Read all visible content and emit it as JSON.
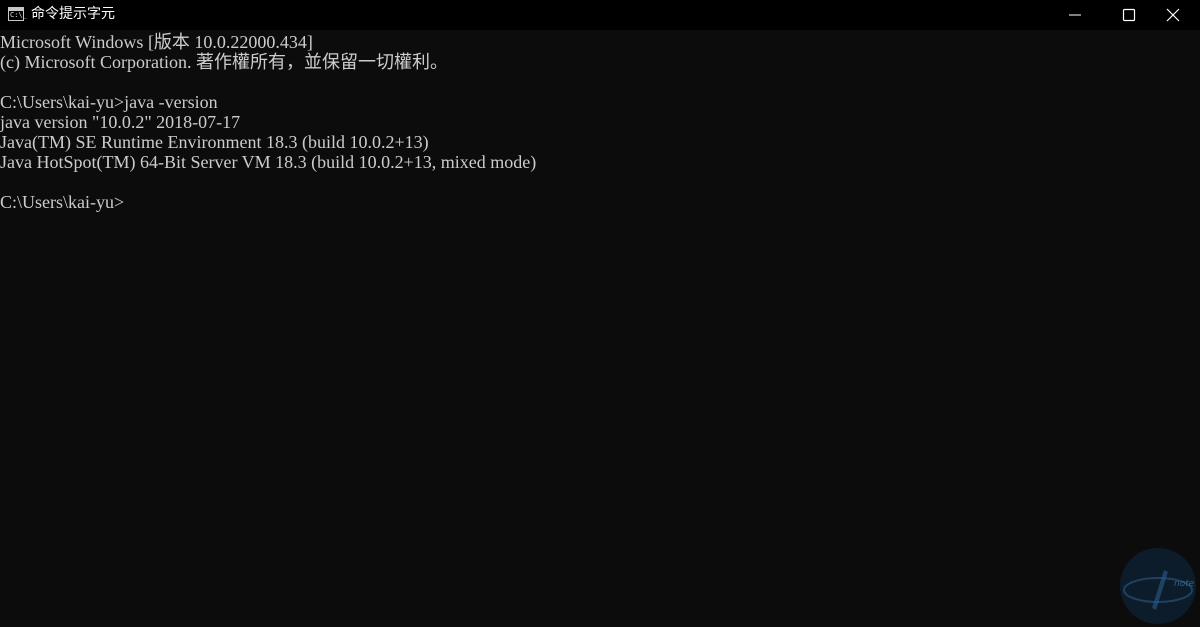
{
  "window": {
    "title": "命令提示字元",
    "app_icon_glyph": "C:\\_"
  },
  "console": {
    "lines": [
      "Microsoft Windows [版本 10.0.22000.434]",
      "(c) Microsoft Corporation. 著作權所有，並保留一切權利。",
      "",
      "C:\\Users\\kai-yu>java -version",
      "java version \"10.0.2\" 2018-07-17",
      "Java(TM) SE Runtime Environment 18.3 (build 10.0.2+13)",
      "Java HotSpot(TM) 64-Bit Server VM 18.3 (build 10.0.2+13, mixed mode)",
      "",
      "C:\\Users\\kai-yu>"
    ]
  },
  "watermark": {
    "text": "note"
  },
  "colors": {
    "background": "#0c0c0c",
    "titlebar": "#000000",
    "text": "#cccccc"
  }
}
